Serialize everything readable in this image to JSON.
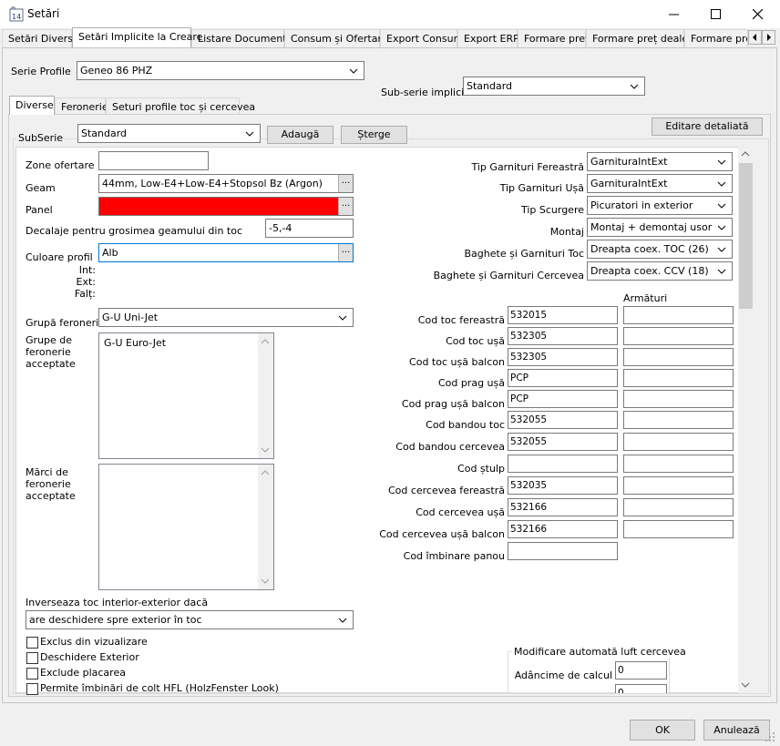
{
  "window": {
    "title": "Setări",
    "app_icon": "app-logo-icon",
    "minimize_icon": "minimize-icon",
    "maximize_icon": "maximize-icon",
    "close_icon": "close-icon"
  },
  "main_tabs": [
    "Setări Diverse",
    "Setări Implicite la Creare",
    "Listare Documente",
    "Consum și Ofertare",
    "Export Consum",
    "Export ERP",
    "Formare preț",
    "Formare preț dealer",
    "Formare preț"
  ],
  "tab_scroll": {
    "left_icon": "scroll-left-icon",
    "right_icon": "scroll-right-icon"
  },
  "serie_profile": {
    "label": "Serie Profile",
    "value": "Geneo 86 PHZ"
  },
  "sub_serie_implicita": {
    "label": "Sub-serie implicită",
    "value": "Standard"
  },
  "inner_tabs": [
    "Diverse",
    "Feronerie",
    "Seturi profile toc și cercevea"
  ],
  "subserie": {
    "label": "SubSerie",
    "value": "Standard",
    "add_label": "Adaugă",
    "delete_label": "Șterge"
  },
  "editare_label": "Editare detaliată",
  "left": {
    "zone_ofertare": {
      "label": "Zone ofertare",
      "value": ""
    },
    "geam": {
      "label": "Geam",
      "value": "44mm, Low-E4+Low-E4+Stopsol Bz (Argon)"
    },
    "panel": {
      "label": "Panel",
      "value": "",
      "color": "#ff0000"
    },
    "decalaje": {
      "label": "Decalaje pentru grosimea geamului din toc",
      "value": "-5,-4"
    },
    "culoare": {
      "label": "Culoare profil",
      "value": "Alb",
      "sub_labels": [
        "Int:",
        "Ext:",
        "Falț:"
      ]
    },
    "grupa_feronerie": {
      "label": "Grupă feronerie",
      "value": "G-U Uni-Jet"
    },
    "grupe_acceptate": {
      "label": "Grupe de feronerie acceptate",
      "items": [
        "G-U Euro-Jet"
      ]
    },
    "marci_acceptate": {
      "label": "Mărci de feronerie acceptate",
      "items": []
    },
    "inverseaza": {
      "label": "Inverseaza toc interior-exterior dacă",
      "value": "are deschidere spre exterior în toc"
    },
    "checkboxes": [
      {
        "label": "Exclus din vizualizare",
        "checked": false
      },
      {
        "label": "Deschidere Exterior",
        "checked": false
      },
      {
        "label": "Exclude placarea",
        "checked": false
      },
      {
        "label": "Permite îmbinări de colt HFL (HolzFenster Look)",
        "checked": false
      }
    ]
  },
  "right": {
    "combos": [
      {
        "label": "Tip Garnituri Fereastră",
        "value": "GarnituraIntExt"
      },
      {
        "label": "Tip Garnituri Ușă",
        "value": "GarnituraIntExt"
      },
      {
        "label": "Tip Scurgere",
        "value": "Picuratori in exterior"
      },
      {
        "label": "Montaj",
        "value": "Montaj + demontaj usor"
      },
      {
        "label": "Baghete și Garnituri Toc",
        "value": "Dreapta coex. TOC (26)"
      },
      {
        "label": "Baghete și Garnituri Cercevea",
        "value": "Dreapta coex. CCV (18)"
      }
    ],
    "armaturi_header": "Armături",
    "codes": [
      {
        "label": "Cod toc fereastră",
        "value": "532015",
        "armatura": ""
      },
      {
        "label": "Cod toc ușă",
        "value": "532305",
        "armatura": ""
      },
      {
        "label": "Cod toc ușă balcon",
        "value": "532305",
        "armatura": ""
      },
      {
        "label": "Cod prag ușă",
        "value": "PCP",
        "armatura": ""
      },
      {
        "label": "Cod prag ușă balcon",
        "value": "PCP",
        "armatura": ""
      },
      {
        "label": "Cod bandou toc",
        "value": "532055",
        "armatura": ""
      },
      {
        "label": "Cod bandou cercevea",
        "value": "532055",
        "armatura": ""
      },
      {
        "label": "Cod ștulp",
        "value": "",
        "armatura": ""
      },
      {
        "label": "Cod cercevea fereastră",
        "value": "532035",
        "armatura": ""
      },
      {
        "label": "Cod cercevea ușă",
        "value": "532166",
        "armatura": ""
      },
      {
        "label": "Cod cercevea ușă balcon",
        "value": "532166",
        "armatura": ""
      },
      {
        "label": "Cod îmbinare panou",
        "value": ""
      }
    ],
    "modificare": {
      "title": "Modificare automată luft cercevea",
      "adancime_label": "Adâncime de calcul",
      "adancime_value": "0",
      "second_value": "0"
    }
  },
  "buttons": {
    "ok": "OK",
    "cancel": "Anulează"
  }
}
